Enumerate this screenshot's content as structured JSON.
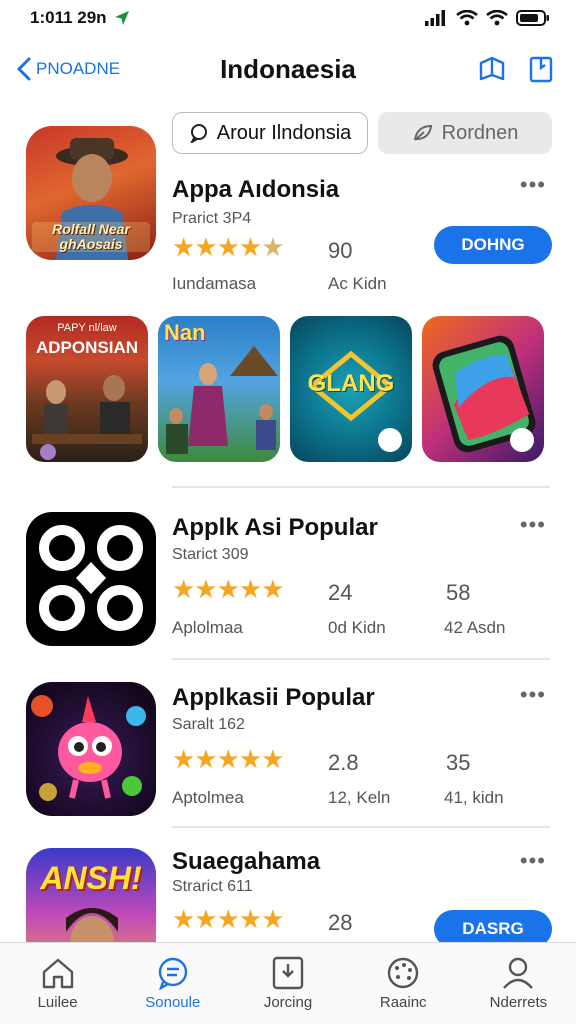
{
  "status": {
    "time": "1:011 29n"
  },
  "nav": {
    "back_label": "Pnoadne",
    "title": "Indonaesia"
  },
  "search": {
    "primary": "Arour Ilndonsia",
    "secondary": "Rordnen"
  },
  "apps": [
    {
      "name": "Appa Aıdonsia",
      "sub": "Prarict 3P4",
      "stat": "90",
      "label_left": "Iundamasa",
      "label_right": "Ac Kidn",
      "button": "DOHNG",
      "icon_text": "Rolfall Near ghAosais",
      "rating": 4
    },
    {
      "name": "Applk Asi Popular",
      "sub": "Starict 309",
      "stat1": "24",
      "stat2": "58",
      "label1": "Aplolmaa",
      "label2": "0d Kidn",
      "label3": "42 Asdn",
      "rating": 5
    },
    {
      "name": "Applkasii Popular",
      "sub": "Saralt 162",
      "stat1": "2.8",
      "stat2": "35",
      "label1": "Aptolmea",
      "label2": "12, Keln",
      "label3": "41, kidn",
      "rating": 5
    },
    {
      "name": "Suaegahama",
      "sub": "Strarict 611",
      "stat": "28",
      "button": "DASRG",
      "icon_text": "ANSH!",
      "rating": 5
    }
  ],
  "screenshots": [
    {
      "title": "ADPONSIAN",
      "top": "PAPY nl/law"
    },
    {
      "title": "Nan"
    },
    {
      "title": "GLANG"
    },
    {
      "title": ""
    }
  ],
  "tabs": [
    {
      "label": "Luilee",
      "icon": "home-icon"
    },
    {
      "label": "Sonoule",
      "icon": "chat-icon"
    },
    {
      "label": "Jorcing",
      "icon": "download-box-icon"
    },
    {
      "label": "Raainc",
      "icon": "palette-icon"
    },
    {
      "label": "Nderrets",
      "icon": "person-icon"
    }
  ],
  "colors": {
    "accent": "#1a73e8",
    "star": "#f5a623"
  }
}
